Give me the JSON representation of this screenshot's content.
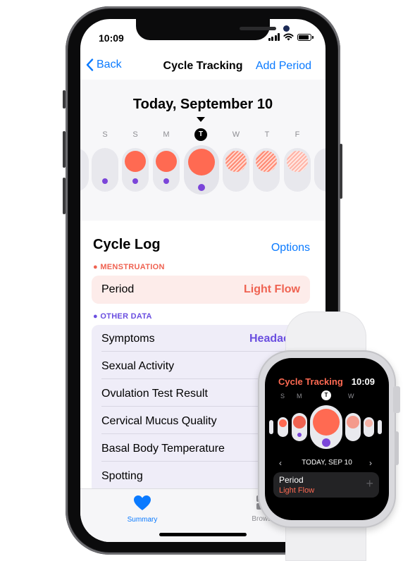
{
  "phone": {
    "status_time": "10:09",
    "nav": {
      "back_label": "Back",
      "title": "Cycle Tracking",
      "add_label": "Add Period"
    },
    "calendar": {
      "date_title": "Today, September 10",
      "days": [
        "S",
        "S",
        "M",
        "T",
        "W",
        "T",
        "F"
      ],
      "today_letter": "T"
    },
    "cycle_log": {
      "title": "Cycle Log",
      "options_label": "Options",
      "menstruation_section": "MENSTRUATION",
      "period_label": "Period",
      "period_value": "Light Flow",
      "other_section": "OTHER DATA",
      "rows": [
        {
          "label": "Symptoms",
          "value": "Headache"
        },
        {
          "label": "Sexual Activity",
          "value": ""
        },
        {
          "label": "Ovulation Test Result",
          "value": ""
        },
        {
          "label": "Cervical Mucus Quality",
          "value": ""
        },
        {
          "label": "Basal Body Temperature",
          "value": ""
        },
        {
          "label": "Spotting",
          "value": ""
        }
      ]
    },
    "tabs": {
      "summary": "Summary",
      "browse": "Browse"
    },
    "colors": {
      "accent": "#0a7aff",
      "period": "#ff6a52",
      "other": "#7b45d9"
    }
  },
  "watch": {
    "title": "Cycle Tracking",
    "time": "10:09",
    "days": [
      "S",
      "M",
      "T",
      "W"
    ],
    "date": "TODAY, SEP 10",
    "card_title": "Period",
    "card_value": "Light Flow"
  }
}
